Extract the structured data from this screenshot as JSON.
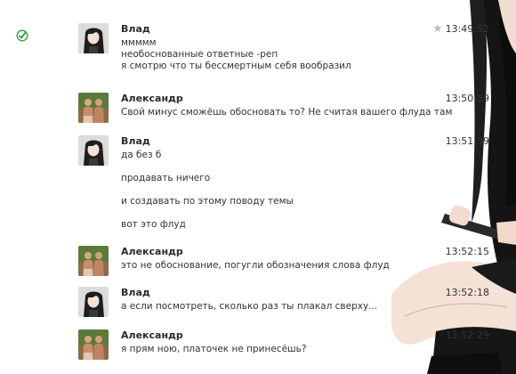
{
  "messages": [
    {
      "sender": "Влад",
      "time": "13:49:52",
      "delivered": true,
      "starred": false,
      "lines": [
        "ммммм",
        "необоснованные ответные -реп",
        "я смотрю что ты бессмертным себя вообразил"
      ]
    },
    {
      "sender": "Александр",
      "time": "13:50:59",
      "lines": [
        "Свой минус сможёшь обосновать то? Не считая вашего флуда там"
      ]
    },
    {
      "sender": "Влад",
      "time": "13:51:39",
      "lines": [
        "да без б",
        "продавать ничего",
        "и создавать по этому поводу темы",
        "вот это флуд"
      ]
    },
    {
      "sender": "Александр",
      "time": "13:52:15",
      "lines": [
        "это не обоснование, погугли обозначения слова флуд"
      ]
    },
    {
      "sender": "Влад",
      "time": "13:52:18",
      "lines": [
        "а если посмотреть, сколько раз ты плакал сверху..."
      ]
    },
    {
      "sender": "Александр",
      "time": "13:52:29",
      "lines": [
        "я прям ною, платочек не принесёшь?"
      ]
    }
  ],
  "icons": {
    "delivered": "check-circle-icon",
    "favorite": "star-icon",
    "vlad_avatar": "anime-girl-avatar",
    "alex_avatar": "two-men-photo-avatar",
    "star_glyph": "★",
    "check_color": "#2e9a3c"
  }
}
